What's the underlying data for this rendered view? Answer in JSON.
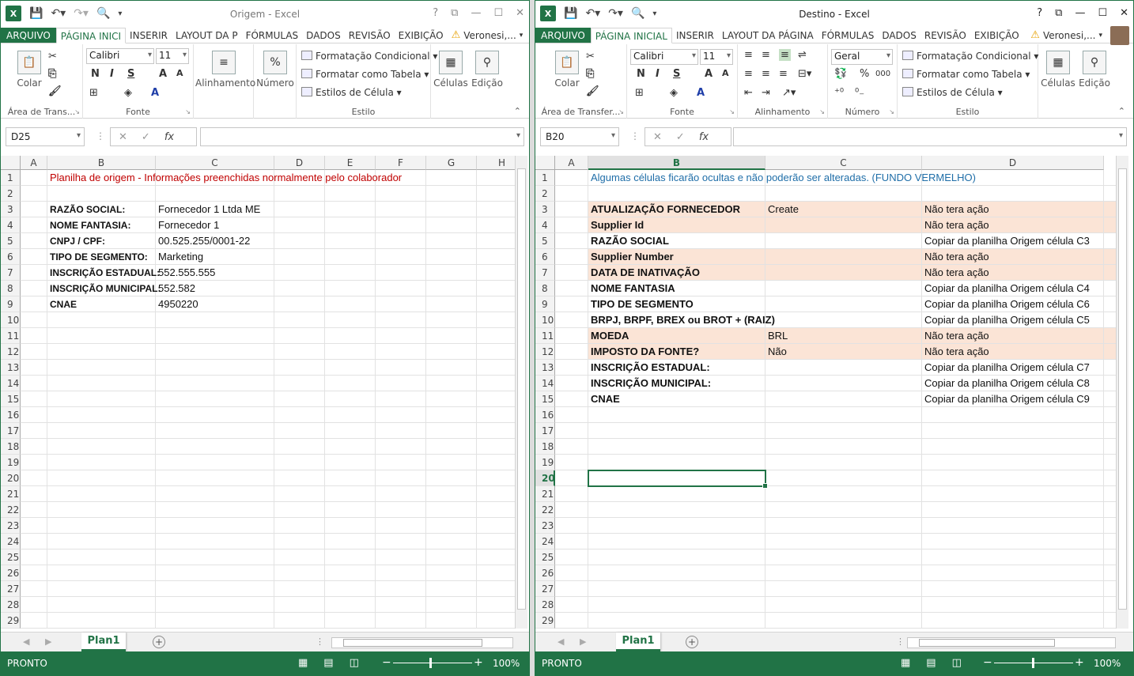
{
  "left": {
    "title": "Origem - Excel",
    "tabs": [
      "ARQUIVO",
      "PÁGINA INICI",
      "INSERIR",
      "LAYOUT DA P",
      "FÓRMULAS",
      "DADOS",
      "REVISÃO",
      "EXIBIÇÃO"
    ],
    "user": "Veronesi,...",
    "ribbon": {
      "paste": "Colar",
      "clipboard_label": "Área de Trans...",
      "font_name": "Calibri",
      "font_size": "11",
      "font_label": "Fonte",
      "alignment": "Alinhamento",
      "number": "Número",
      "percent": "%",
      "cond_format": "Formatação Condicional",
      "format_table": "Formatar como Tabela",
      "cell_styles": "Estilos de Célula",
      "style_label": "Estilo",
      "cells": "Células",
      "editing": "Edição"
    },
    "name_box": "D25",
    "columns": [
      "A",
      "B",
      "C",
      "D",
      "E",
      "F",
      "G",
      "H"
    ],
    "rows": [
      "1",
      "2",
      "3",
      "4",
      "5",
      "6",
      "7",
      "8",
      "9",
      "10",
      "11",
      "12",
      "13",
      "14",
      "15",
      "16",
      "17",
      "18",
      "19",
      "20",
      "21",
      "22",
      "23",
      "24",
      "25",
      "26",
      "27",
      "28",
      "29"
    ],
    "header_text": "Planilha de origem - Informações preenchidas normalmente pelo colaborador",
    "data": [
      {
        "label": "RAZÃO SOCIAL:",
        "value": "Fornecedor 1 Ltda ME"
      },
      {
        "label": "NOME FANTASIA:",
        "value": "Fornecedor 1"
      },
      {
        "label": "CNPJ / CPF:",
        "value": "00.525.255/0001-22"
      },
      {
        "label": "TIPO DE SEGMENTO:",
        "value": "Marketing"
      },
      {
        "label": "INSCRIÇÃO ESTADUAL:",
        "value": "552.555.555"
      },
      {
        "label": "INSCRIÇÃO MUNICIPAL:",
        "value": "552.582"
      },
      {
        "label": "CNAE",
        "value": "4950220"
      }
    ],
    "sheet": "Plan1",
    "status": "PRONTO",
    "zoom": "100%"
  },
  "right": {
    "title": "Destino - Excel",
    "tabs": [
      "ARQUIVO",
      "PÁGINA INICIAL",
      "INSERIR",
      "LAYOUT DA PÁGINA",
      "FÓRMULAS",
      "DADOS",
      "REVISÃO",
      "EXIBIÇÃO"
    ],
    "user": "Veronesi,...",
    "ribbon": {
      "paste": "Colar",
      "clipboard_label": "Área de Transfer...",
      "font_name": "Calibri",
      "font_size": "11",
      "font_label": "Fonte",
      "alignment_label": "Alinhamento",
      "number_format": "Geral",
      "number_label": "Número",
      "percent": "%",
      "thousands": "000",
      "cond_format": "Formatação Condicional",
      "format_table": "Formatar como Tabela",
      "cell_styles": "Estilos de Célula",
      "style_label": "Estilo",
      "cells": "Células",
      "editing": "Edição"
    },
    "name_box": "B20",
    "columns": [
      "A",
      "B",
      "C",
      "D"
    ],
    "rows": [
      "1",
      "2",
      "3",
      "4",
      "5",
      "6",
      "7",
      "8",
      "9",
      "10",
      "11",
      "12",
      "13",
      "14",
      "15",
      "16",
      "17",
      "18",
      "19",
      "20",
      "21",
      "22",
      "23",
      "24",
      "25",
      "26",
      "27",
      "28",
      "29"
    ],
    "header_text": "Algumas células ficarão ocultas e não poderão ser alteradas. (FUNDO VERMELHO)",
    "data": [
      {
        "label": "ATUALIZAÇÃO FORNECEDOR",
        "c": "Create",
        "d": "Não tera ação",
        "shaded": true
      },
      {
        "label": "Supplier Id",
        "c": "",
        "d": "Não tera ação",
        "shaded": true
      },
      {
        "label": "RAZÃO SOCIAL",
        "c": "",
        "d": "Copiar da planilha Origem célula C3",
        "shaded": false
      },
      {
        "label": "Supplier Number",
        "c": "",
        "d": "Não tera ação",
        "shaded": true
      },
      {
        "label": "DATA DE INATIVAÇÃO",
        "c": "",
        "d": "Não tera ação",
        "shaded": true
      },
      {
        "label": "NOME FANTASIA",
        "c": "",
        "d": "Copiar da planilha Origem célula C4",
        "shaded": false
      },
      {
        "label": "TIPO DE SEGMENTO",
        "c": "",
        "d": "Copiar da planilha Origem célula C6",
        "shaded": false
      },
      {
        "label": "BRPJ, BRPF, BREX ou BROT + (RAIZ)",
        "c": "",
        "d": "Copiar da planilha Origem célula C5",
        "shaded": false
      },
      {
        "label": "MOEDA",
        "c": "BRL",
        "d": "Não tera ação",
        "shaded": true
      },
      {
        "label": "IMPOSTO DA FONTE?",
        "c": "Não",
        "d": "Não tera ação",
        "shaded": true
      },
      {
        "label": "INSCRIÇÃO ESTADUAL:",
        "c": "",
        "d": "Copiar da planilha Origem célula C7",
        "shaded": false
      },
      {
        "label": "INSCRIÇÃO MUNICIPAL:",
        "c": "",
        "d": "Copiar da planilha Origem célula C8",
        "shaded": false
      },
      {
        "label": "CNAE",
        "c": "",
        "d": "Copiar da planilha Origem célula C9",
        "shaded": false
      }
    ],
    "sheet": "Plan1",
    "status": "PRONTO",
    "zoom": "100%"
  },
  "colors": {
    "accent": "#217346",
    "shade": "#fbe4d6",
    "red_text": "#c00000",
    "blue_text": "#1f6ea8"
  }
}
